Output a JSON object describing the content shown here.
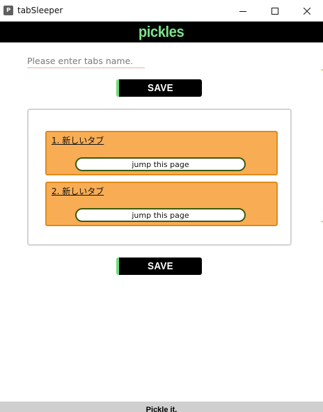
{
  "window": {
    "title": "tabSleeper",
    "app_icon_letter": "P"
  },
  "header": {
    "brand": "pickles",
    "brand_color": "#7be38a"
  },
  "form": {
    "placeholder": "Please enter tabs name.",
    "value": ""
  },
  "buttons": {
    "save_top": "SAVE",
    "save_bottom": "SAVE",
    "accent_color": "#6ddc82"
  },
  "tabs": [
    {
      "label": "1. 新しいタブ",
      "jump_label": "jump this page"
    },
    {
      "label": "2. 新しいタブ",
      "jump_label": "jump this page"
    }
  ],
  "colors": {
    "card_fill": "#f8ad55",
    "card_border": "#e08a1a",
    "jump_border": "#3b5a10"
  },
  "icons": {
    "app": "app-icon",
    "minimize": "minimize-icon",
    "maximize": "maximize-icon",
    "close": "close-icon"
  },
  "footer": {
    "text": "Pickle it."
  }
}
